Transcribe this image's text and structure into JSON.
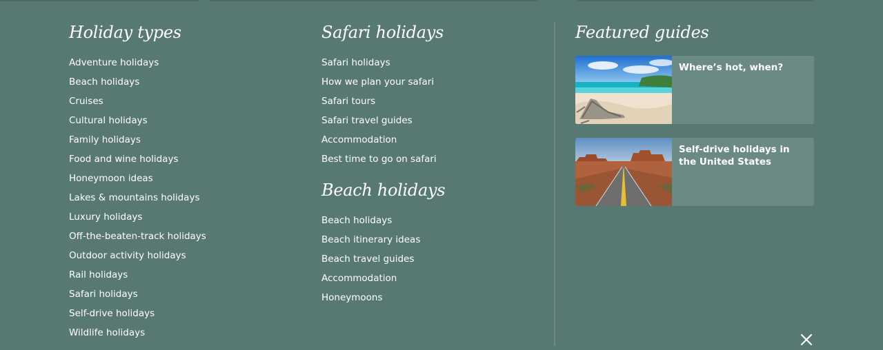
{
  "holiday_types": {
    "heading": "Holiday types",
    "items": [
      "Adventure holidays",
      "Beach holidays",
      "Cruises",
      "Cultural holidays",
      "Family holidays",
      "Food and wine holidays",
      "Honeymoon ideas",
      "Lakes & mountains holidays",
      "Luxury holidays",
      "Off-the-beaten-track holidays",
      "Outdoor activity holidays",
      "Rail holidays",
      "Safari holidays",
      "Self-drive holidays",
      "Wildlife holidays"
    ]
  },
  "safari_holidays": {
    "heading": "Safari holidays",
    "items": [
      "Safari holidays",
      "How we plan your safari",
      "Safari tours",
      "Safari travel guides",
      "Accommodation",
      "Best time to go on safari"
    ]
  },
  "beach_holidays": {
    "heading": "Beach holidays",
    "items": [
      "Beach holidays",
      "Beach itinerary ideas",
      "Beach travel guides",
      "Accommodation",
      "Honeymoons"
    ]
  },
  "featured_guides": {
    "heading": "Featured guides",
    "cards": [
      {
        "title": "Where’s hot, when?",
        "image": "tropical-beach-photo"
      },
      {
        "title": "Self-drive holidays in the United States",
        "image": "desert-road-photo"
      }
    ]
  },
  "close_icon": "close-icon",
  "colors": {
    "background": "#587873",
    "card": "#6b8a84",
    "divider": "#6d8c87",
    "text": "#ffffff"
  }
}
